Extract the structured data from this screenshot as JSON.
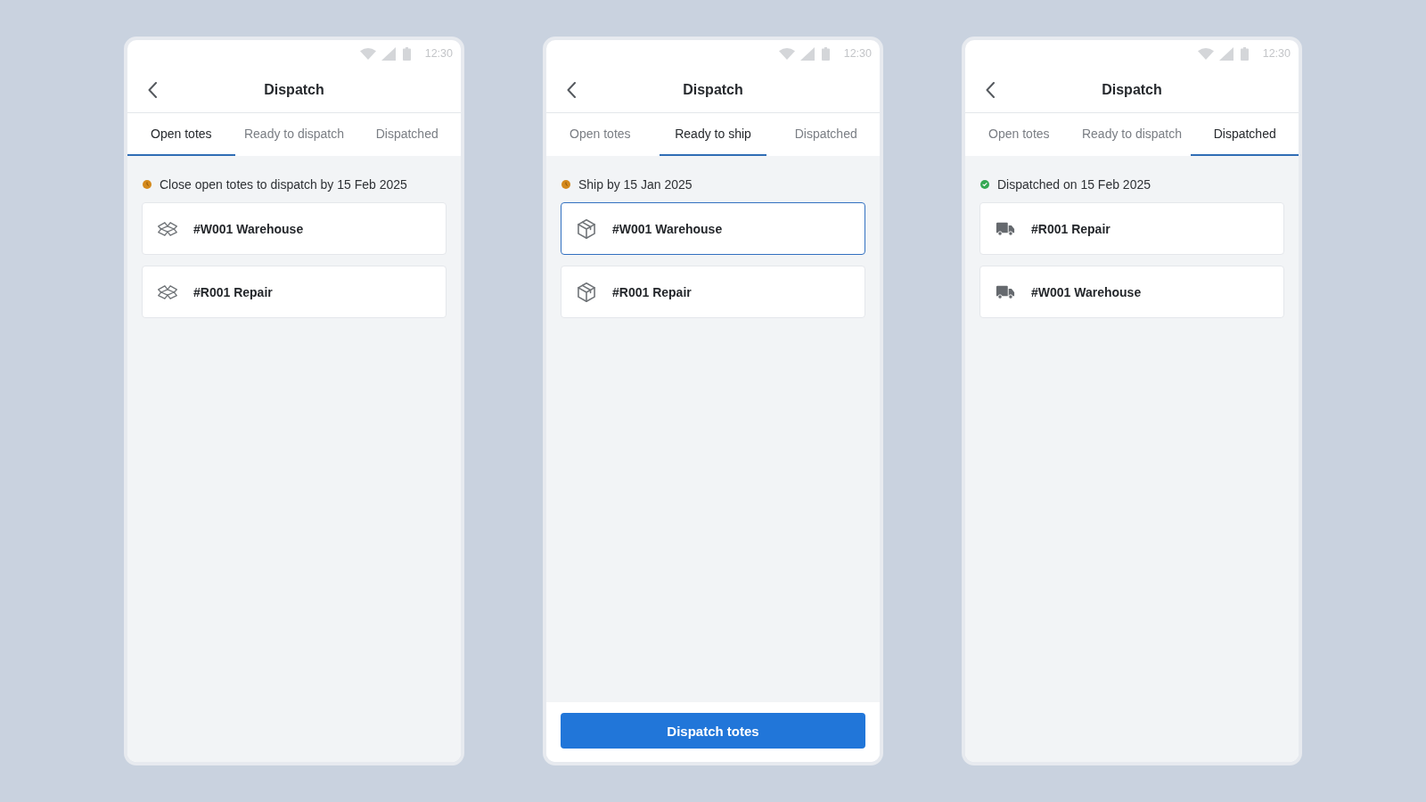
{
  "screens": [
    {
      "status_bar": {
        "time": "12:30"
      },
      "title": "Dispatch",
      "tabs": [
        {
          "label": "Open totes",
          "selected": true
        },
        {
          "label": "Ready to dispatch",
          "selected": false
        },
        {
          "label": "Dispatched",
          "selected": false
        }
      ],
      "notice": {
        "kind": "due",
        "color": "#d4891c",
        "text": "Close open totes to dispatch by 15 Feb 2025"
      },
      "totes": [
        {
          "kind": "open",
          "label": "#W001 Warehouse",
          "selected": false
        },
        {
          "kind": "open",
          "label": "#R001 Repair",
          "selected": false
        }
      ]
    },
    {
      "status_bar": {
        "time": "12:30"
      },
      "title": "Dispatch",
      "tabs": [
        {
          "label": "Open totes",
          "selected": false
        },
        {
          "label": "Ready to ship",
          "selected": true
        },
        {
          "label": "Dispatched",
          "selected": false
        }
      ],
      "notice": {
        "kind": "due",
        "color": "#d4891c",
        "text": "Ship by 15 Jan 2025"
      },
      "totes": [
        {
          "kind": "packed",
          "label": "#W001 Warehouse",
          "selected": true
        },
        {
          "kind": "packed",
          "label": "#R001 Repair",
          "selected": false
        }
      ],
      "primary_button": {
        "label": "Dispatch totes"
      }
    },
    {
      "status_bar": {
        "time": "12:30"
      },
      "title": "Dispatch",
      "tabs": [
        {
          "label": "Open totes",
          "selected": false
        },
        {
          "label": "Ready to dispatch",
          "selected": false
        },
        {
          "label": "Dispatched",
          "selected": true
        }
      ],
      "notice": {
        "kind": "done",
        "color": "#35a853",
        "text": "Dispatched on 15 Feb 2025"
      },
      "totes": [
        {
          "kind": "shipped",
          "label": "#R001 Repair",
          "selected": false
        },
        {
          "kind": "shipped",
          "label": "#W001 Warehouse",
          "selected": false
        }
      ]
    }
  ]
}
